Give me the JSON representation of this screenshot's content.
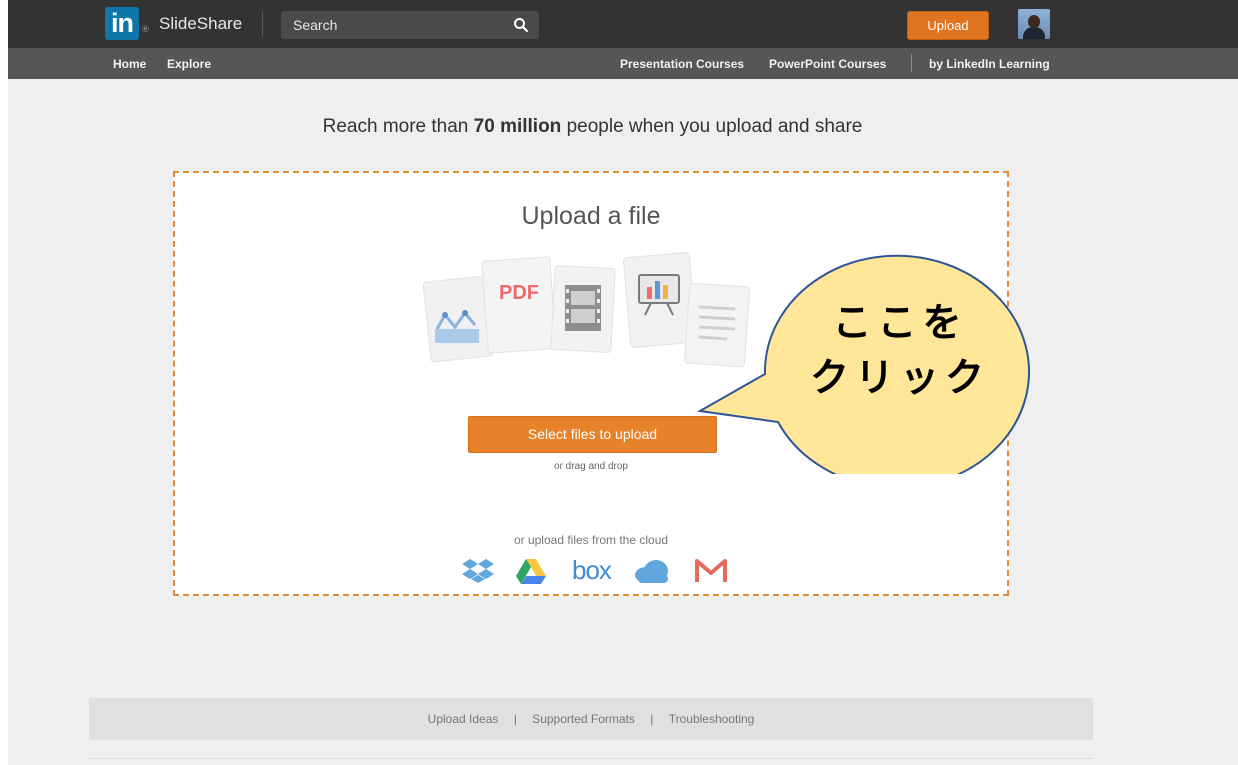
{
  "header": {
    "logo_in": "in",
    "logo_reg": "®",
    "logo_text": "SlideShare",
    "search_placeholder": "Search",
    "upload_label": "Upload"
  },
  "subnav": {
    "home": "Home",
    "explore": "Explore",
    "presentation_courses": "Presentation Courses",
    "powerpoint_courses": "PowerPoint Courses",
    "linkedin_learning": "by LinkedIn Learning"
  },
  "main": {
    "tagline_pre": "Reach more than ",
    "tagline_bold": "70 million",
    "tagline_post": " people when you upload and share",
    "upload_title": "Upload a file",
    "file_art_pdf": "PDF",
    "select_button": "Select files to upload",
    "drag_text": "or drag and drop",
    "cloud_text": "or upload files from the cloud",
    "cloud_box": "box",
    "cloud_services": [
      "dropbox-icon",
      "google-drive-icon",
      "box-icon",
      "onedrive-icon",
      "gmail-icon"
    ]
  },
  "callout": {
    "line1": "ここを",
    "line2": "クリック"
  },
  "footer": {
    "upload_ideas": "Upload Ideas",
    "supported_formats": "Supported Formats",
    "troubleshooting": "Troubleshooting",
    "separator": "|"
  },
  "colors": {
    "topbar": "#333333",
    "subnav": "#565656",
    "accent_orange": "#e8822a",
    "linkedin_blue": "#0e76a8",
    "callout_fill": "#ffe699",
    "callout_stroke": "#2f5597"
  }
}
